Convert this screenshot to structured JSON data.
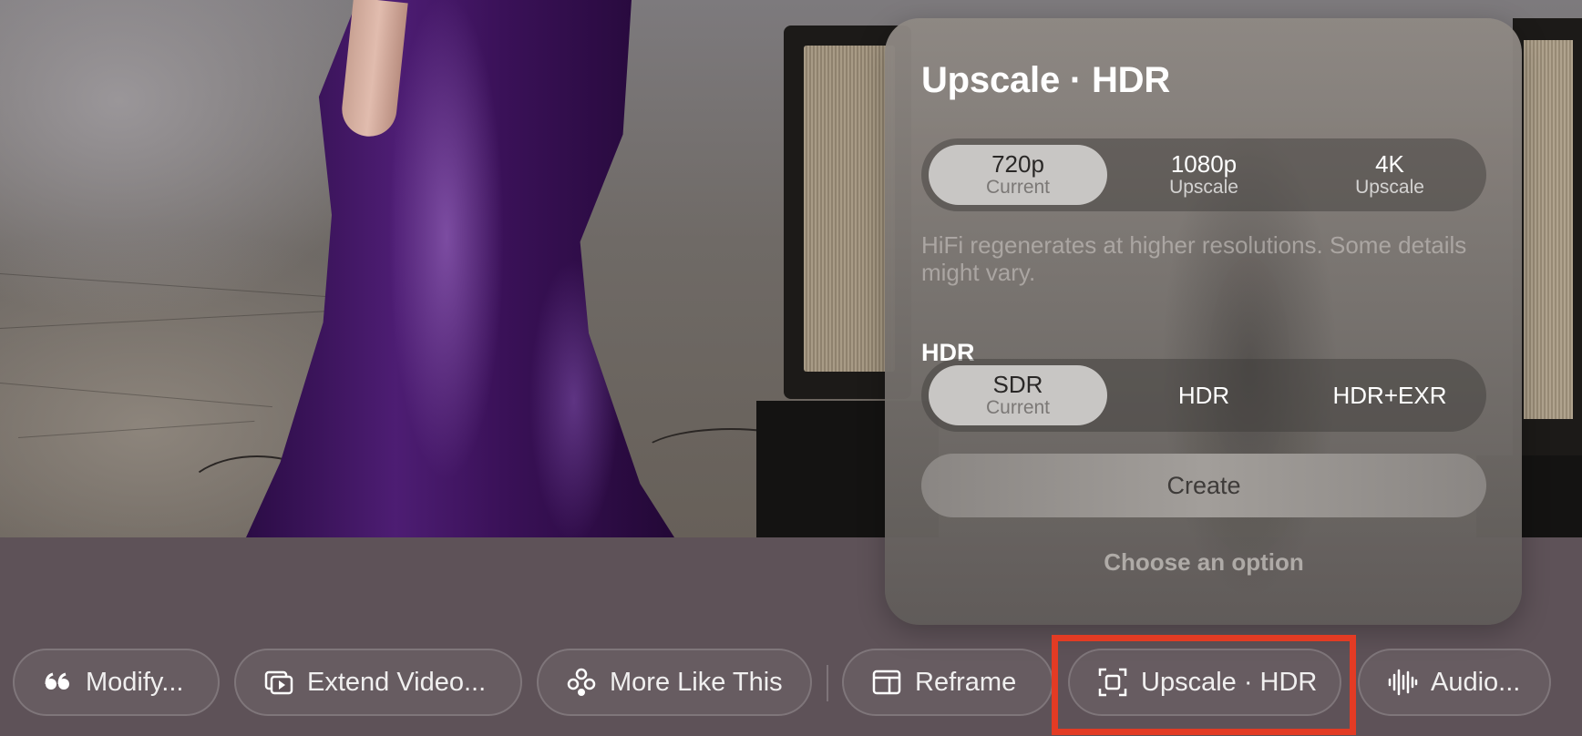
{
  "panel": {
    "title": "Upscale · HDR",
    "resolution_options": [
      {
        "label": "720p",
        "sub": "Current",
        "selected": true
      },
      {
        "label": "1080p",
        "sub": "Upscale",
        "selected": false
      },
      {
        "label": "4K",
        "sub": "Upscale",
        "selected": false
      }
    ],
    "description": "HiFi regenerates at higher resolutions. Some details might vary.",
    "hdr_label": "HDR",
    "hdr_options": [
      {
        "label": "SDR",
        "sub": "Current",
        "selected": true
      },
      {
        "label": "HDR",
        "sub": "",
        "selected": false
      },
      {
        "label": "HDR+EXR",
        "sub": "",
        "selected": false
      }
    ],
    "create_label": "Create",
    "hint": "Choose an option"
  },
  "toolbar": {
    "items": [
      {
        "label": "Modify...",
        "icon": "quote-icon"
      },
      {
        "label": "Extend Video...",
        "icon": "extend-video-icon"
      },
      {
        "label": "More Like This",
        "icon": "more-like-this-icon"
      },
      {
        "label": "Reframe",
        "icon": "reframe-icon"
      },
      {
        "label": "Upscale · HDR",
        "icon": "upscale-icon"
      },
      {
        "label": "Audio...",
        "icon": "audio-waveform-icon"
      }
    ]
  },
  "colors": {
    "highlight": "#e33b24",
    "selected_segment": "#c8c6c4",
    "background": "#5e5258"
  }
}
